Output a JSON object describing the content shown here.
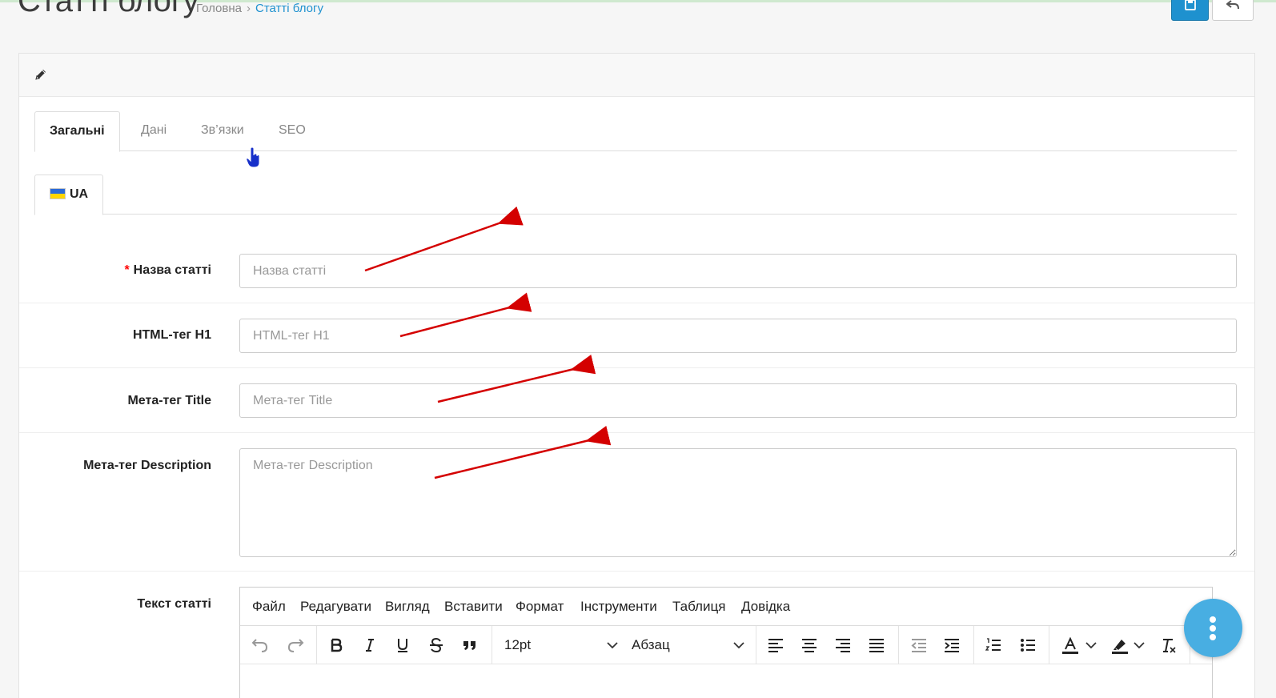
{
  "header": {
    "title": "Статті блогу",
    "breadcrumb": {
      "home": "Головна",
      "separator": "›",
      "current": "Статті блогу"
    }
  },
  "tabs": [
    {
      "label": "Загальні",
      "active": true
    },
    {
      "label": "Дані",
      "active": false
    },
    {
      "label": "Зв’язки",
      "active": false
    },
    {
      "label": "SEO",
      "active": false
    }
  ],
  "language_tab": {
    "label": "UA",
    "flag": "ukraine-flag-icon"
  },
  "form": {
    "title": {
      "required_mark": "*",
      "label": "Назва статті",
      "placeholder": "Назва статті"
    },
    "h1": {
      "label": "HTML-тег H1",
      "placeholder": "HTML-тег H1"
    },
    "meta_title": {
      "label": "Мета-тег Title",
      "placeholder": "Мета-тег Title"
    },
    "meta_description": {
      "label": "Мета-тег Description",
      "placeholder": "Мета-тег Description"
    },
    "article_text": {
      "label": "Текст статті"
    }
  },
  "editor": {
    "menu": [
      "Файл",
      "Редагувати",
      "Вигляд",
      "Вставити",
      "Формат",
      "Інструменти",
      "Таблиця",
      "Довідка"
    ],
    "font_size": "12pt",
    "block_format": "Абзац"
  },
  "colors": {
    "accent": "#1e91cf",
    "fab": "#48aee2",
    "required": "#ff0000",
    "annotation_arrow": "#d40000"
  }
}
